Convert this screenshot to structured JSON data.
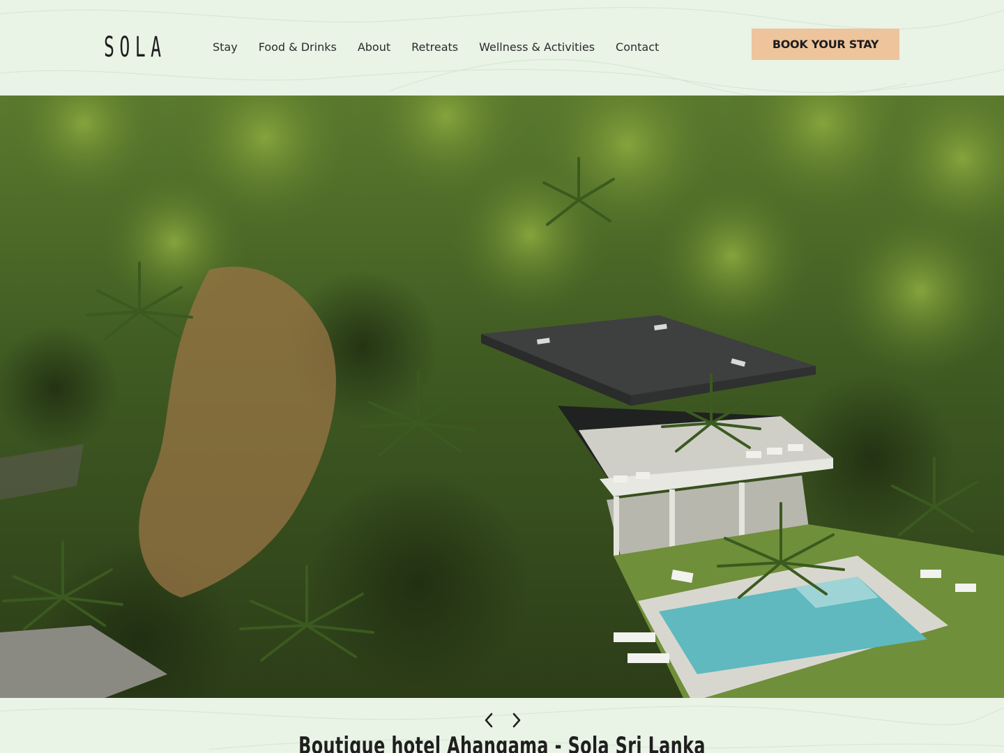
{
  "header": {
    "logo": "SOLA",
    "nav": [
      {
        "label": "Stay"
      },
      {
        "label": "Food & Drinks"
      },
      {
        "label": "About"
      },
      {
        "label": "Retreats"
      },
      {
        "label": "Wellness & Activities"
      },
      {
        "label": "Contact"
      }
    ],
    "book_button": "BOOK YOUR STAY"
  },
  "hero": {
    "image": "aerial-view-hotel-jungle-pool"
  },
  "slider": {
    "prev_icon": "chevron-left-icon",
    "next_icon": "chevron-right-icon"
  },
  "main": {
    "headline": "Boutique hotel Ahangama - Sola Sri Lanka"
  },
  "colors": {
    "background": "#e9f3e6",
    "button": "#eec49c",
    "text": "#2a2a2a"
  }
}
